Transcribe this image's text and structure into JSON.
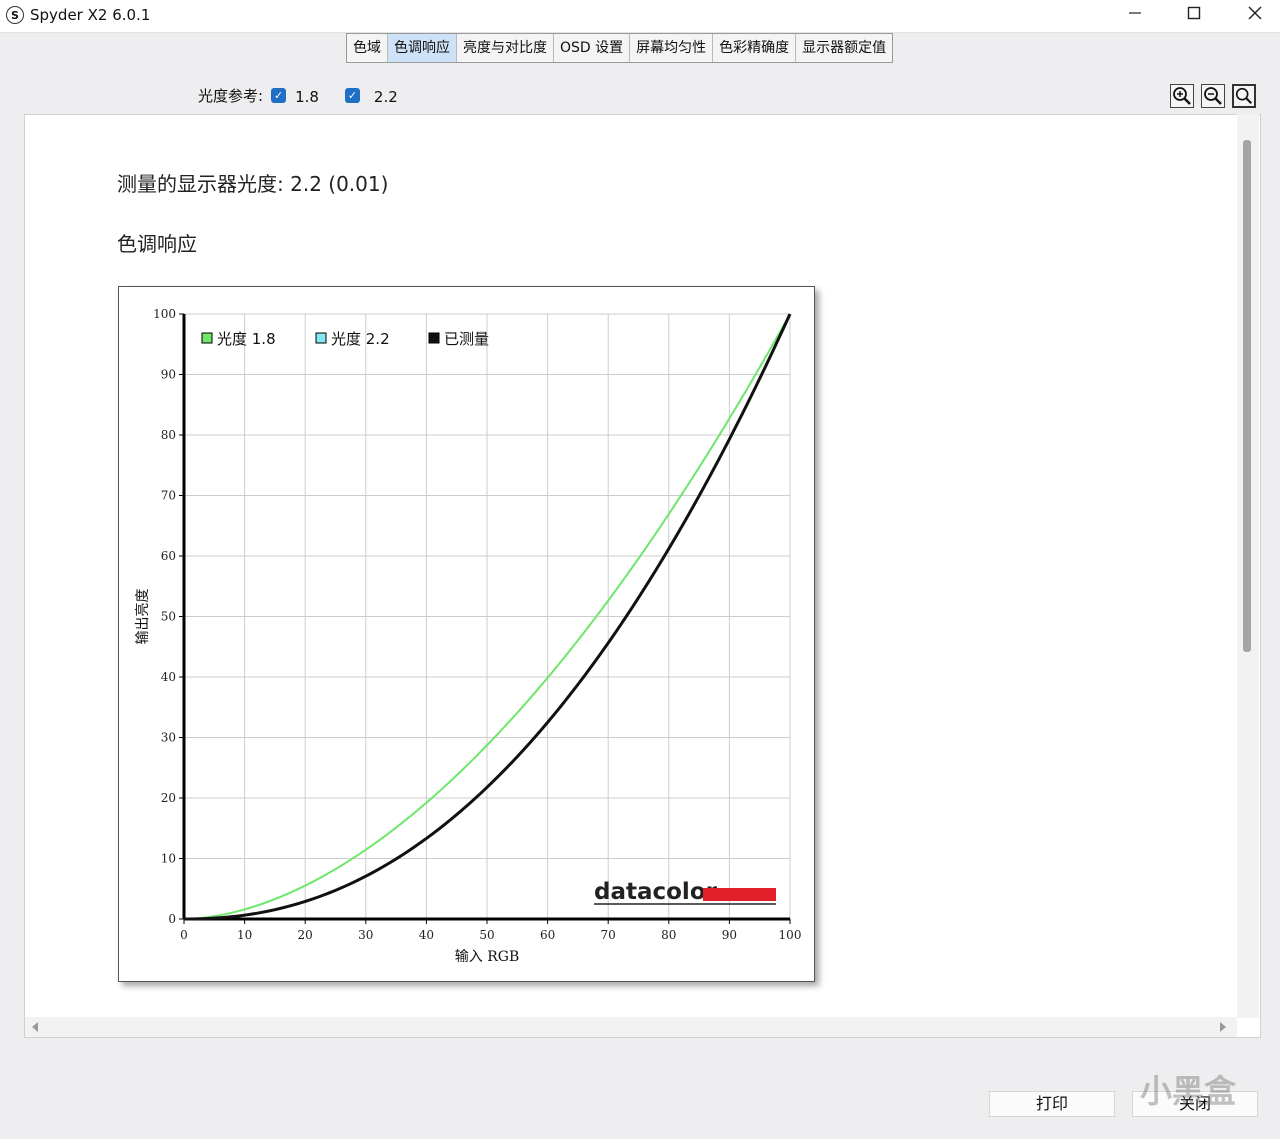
{
  "window": {
    "title": "Spyder X2 6.0.1",
    "icon_letter": "S"
  },
  "tabs": [
    "色域",
    "色调响应",
    "亮度与对比度",
    "OSD 设置",
    "屏幕均匀性",
    "色彩精确度",
    "显示器额定值"
  ],
  "active_tab": 1,
  "gamma_ref": {
    "label": "光度参考:",
    "opt1": "1.8",
    "opt2": "2.2",
    "check_glyph": "✓"
  },
  "report": {
    "measured_label": "测量的显示器光度:",
    "measured_value": "2.2 (0.01)",
    "section_title": "色调响应"
  },
  "buttons": {
    "print": "打印",
    "close": "关闭"
  },
  "watermark": {
    "text": "小黑盒"
  },
  "chart_data": {
    "type": "line",
    "xlabel": "输入 RGB",
    "ylabel": "输出亮度",
    "xlim": [
      0,
      100
    ],
    "ylim": [
      0,
      100
    ],
    "xticks": [
      "0",
      "10",
      "20",
      "30",
      "40",
      "50",
      "60",
      "70",
      "80",
      "90",
      "100"
    ],
    "yticks": [
      "0",
      "10",
      "20",
      "30",
      "40",
      "50",
      "60",
      "70",
      "80",
      "90",
      "100"
    ],
    "grid": true,
    "legend_position": "top-left",
    "brand": "datacolor",
    "series": [
      {
        "name": "光度 1.8",
        "gamma": 1.8,
        "color": "#6ee66a"
      },
      {
        "name": "光度 2.2",
        "gamma": 2.2,
        "color": "#7fe8f0"
      },
      {
        "name": "已测量",
        "gamma": 2.2,
        "color": "#111111"
      }
    ],
    "colors": {
      "brand_bar": "#e1202a",
      "axis": "#000000",
      "grid": "#cccccc"
    }
  }
}
